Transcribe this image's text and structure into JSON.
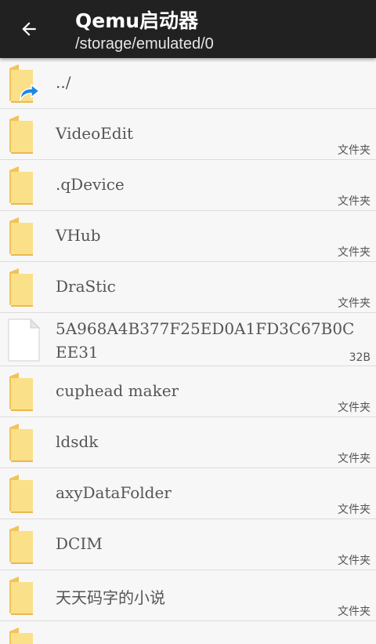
{
  "header": {
    "title": "Qemu启动器",
    "path": "/storage/emulated/0"
  },
  "icons": {
    "back": "arrow-left-icon",
    "folder": "folder-icon",
    "parent": "folder-up-icon",
    "file": "file-icon"
  },
  "colors": {
    "appbar": "#212121",
    "folder_light": "#fde58f",
    "folder_dark": "#f4c55c",
    "shortcut_arrow": "#1e88e5"
  },
  "items": [
    {
      "name": "../",
      "meta": "",
      "kind": "parent"
    },
    {
      "name": "VideoEdit",
      "meta": "文件夹",
      "kind": "folder"
    },
    {
      "name": ".qDevice",
      "meta": "文件夹",
      "kind": "folder"
    },
    {
      "name": "VHub",
      "meta": "文件夹",
      "kind": "folder"
    },
    {
      "name": "DraStic",
      "meta": "文件夹",
      "kind": "folder"
    },
    {
      "name": "5A968A4B377F25ED0A1FD3C67B0CEE31",
      "meta": "32B",
      "kind": "file"
    },
    {
      "name": "cuphead maker",
      "meta": "文件夹",
      "kind": "folder"
    },
    {
      "name": "ldsdk",
      "meta": "文件夹",
      "kind": "folder"
    },
    {
      "name": "axyDataFolder",
      "meta": "文件夹",
      "kind": "folder"
    },
    {
      "name": "DCIM",
      "meta": "文件夹",
      "kind": "folder"
    },
    {
      "name": "天天码字的小说",
      "meta": "文件夹",
      "kind": "folder"
    },
    {
      "name": "",
      "meta": "",
      "kind": "folder"
    }
  ]
}
